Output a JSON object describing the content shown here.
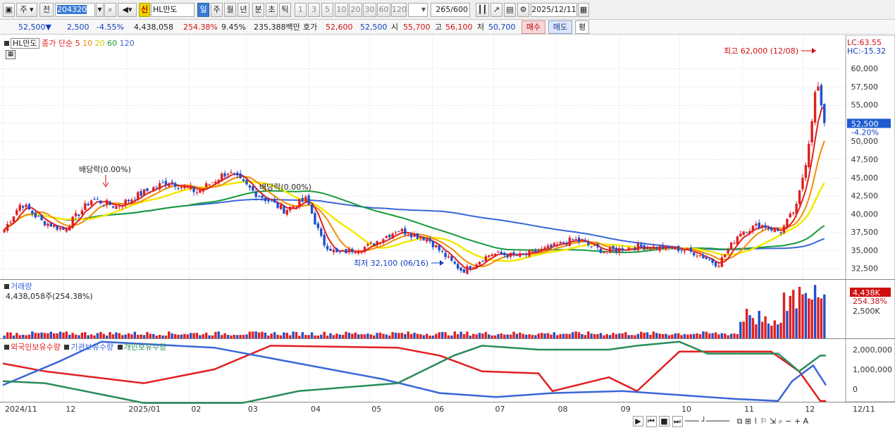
{
  "toolbar": {
    "market": "주",
    "prefix": "전",
    "code": "204320",
    "credit_badge": "신",
    "stock_name": "HL만도",
    "periods": [
      "일",
      "주",
      "월",
      "년",
      "분",
      "초",
      "틱"
    ],
    "active_period": "일",
    "intervals": [
      "1",
      "3",
      "5",
      "10",
      "20",
      "30",
      "60",
      "120"
    ],
    "count": "265",
    "count_max": "/600",
    "date": "2025/12/11"
  },
  "quote": {
    "price": "52,500",
    "direction": "▼",
    "change": "2,500",
    "change_pct": "-4.55%",
    "volume": "4,438,058",
    "volume_ratio": "254.38%",
    "turnover": "9.45%",
    "amount": "235,388백만",
    "ask_label": "호가",
    "ask": "52,600",
    "bid": "52,500",
    "open_label": "시",
    "open": "55,700",
    "high_label": "고",
    "high": "56,100",
    "low_label": "저",
    "low": "50,700",
    "buy_label": "매수",
    "sell_label": "매도",
    "eval_label": "평"
  },
  "price_legend": {
    "name": "HL만도",
    "ma_label": "종가 단순",
    "periods": [
      "5",
      "10",
      "20",
      "60",
      "120"
    ]
  },
  "volume_legend": {
    "title": "거래량",
    "value": "4,438,058주(254.38%)"
  },
  "holder_legend": {
    "foreign": "외국인보유수량",
    "institution": "기관보유수량",
    "individual": "개인보유수량"
  },
  "colors": {
    "up": "#e02020",
    "down": "#2050d0",
    "ma5": "#e02020",
    "ma10": "#f08c00",
    "ma20": "#f5e800",
    "ma60": "#1a9a3a",
    "ma120": "#3a66d8",
    "foreign": "#e02020",
    "institution": "#3a66d8",
    "individual": "#2a8c5a"
  },
  "chart_data": [
    {
      "type": "candlestick",
      "title": "HL만도",
      "y_ticks": [
        "32,500",
        "35,000",
        "37,500",
        "40,000",
        "42,500",
        "45,000",
        "47,500",
        "50,000",
        "52,500",
        "55,000",
        "57,500",
        "60,000"
      ],
      "ylim": [
        31000,
        64000
      ],
      "x_ticks": [
        "2024/11",
        "12",
        "2025/01",
        "02",
        "03",
        "04",
        "05",
        "06",
        "07",
        "08",
        "09",
        "10",
        "11",
        "12",
        "12/11"
      ],
      "series_close": [
        {
          "x": "2024-11-01",
          "y": 37500
        },
        {
          "x": "2024-11-10",
          "y": 41500
        },
        {
          "x": "2024-11-20",
          "y": 39000
        },
        {
          "x": "2024-12-01",
          "y": 37800
        },
        {
          "x": "2024-12-15",
          "y": 42000
        },
        {
          "x": "2024-12-27",
          "y": 41000
        },
        {
          "x": "2025-01-10",
          "y": 43000
        },
        {
          "x": "2025-01-22",
          "y": 44500
        },
        {
          "x": "2025-02-05",
          "y": 43000
        },
        {
          "x": "2025-02-20",
          "y": 45800
        },
        {
          "x": "2025-03-05",
          "y": 43000
        },
        {
          "x": "2025-03-20",
          "y": 40500
        },
        {
          "x": "2025-03-31",
          "y": 42000
        },
        {
          "x": "2025-04-08",
          "y": 36000
        },
        {
          "x": "2025-04-15",
          "y": 34500
        },
        {
          "x": "2025-04-30",
          "y": 35500
        },
        {
          "x": "2025-05-15",
          "y": 37800
        },
        {
          "x": "2025-05-30",
          "y": 36500
        },
        {
          "x": "2025-06-10",
          "y": 33500
        },
        {
          "x": "2025-06-16",
          "y": 32100
        },
        {
          "x": "2025-06-30",
          "y": 34500
        },
        {
          "x": "2025-07-15",
          "y": 34200
        },
        {
          "x": "2025-07-31",
          "y": 35500
        },
        {
          "x": "2025-08-10",
          "y": 36500
        },
        {
          "x": "2025-08-25",
          "y": 34800
        },
        {
          "x": "2025-09-10",
          "y": 35500
        },
        {
          "x": "2025-09-30",
          "y": 35200
        },
        {
          "x": "2025-10-10",
          "y": 34500
        },
        {
          "x": "2025-10-20",
          "y": 33000
        },
        {
          "x": "2025-10-31",
          "y": 37500
        },
        {
          "x": "2025-11-10",
          "y": 38500
        },
        {
          "x": "2025-11-20",
          "y": 37500
        },
        {
          "x": "2025-11-28",
          "y": 41000
        },
        {
          "x": "2025-12-03",
          "y": 48000
        },
        {
          "x": "2025-12-08",
          "y": 58500
        },
        {
          "x": "2025-12-11",
          "y": 52500
        }
      ],
      "series": [
        {
          "name": "5",
          "color": "#e02020"
        },
        {
          "name": "10",
          "color": "#f08c00"
        },
        {
          "name": "20",
          "color": "#f5e800"
        },
        {
          "name": "60",
          "color": "#1a9a3a"
        },
        {
          "name": "120",
          "color": "#3a66d8"
        }
      ],
      "annotations": [
        {
          "text": "최고 62,000 (12/08)"
        },
        {
          "text": "최저 32,100 (06/16)"
        },
        {
          "text": "배당락(0.00%)"
        },
        {
          "text": "배당락(0.00%)"
        }
      ],
      "right_labels": {
        "lc": "LC:63.55",
        "hc": "HC:-15.32",
        "price": "52,500",
        "pct": "-4.20%"
      }
    },
    {
      "type": "bar",
      "title": "거래량",
      "y_ticks": [
        "2,500K"
      ],
      "last_value_label": "4,438K",
      "last_pct_label": "254.38%"
    },
    {
      "type": "line",
      "y_ticks": [
        "2,000,000",
        "1,000,000",
        "0"
      ],
      "series": [
        {
          "name": "외국인보유수량",
          "color": "#e02020"
        },
        {
          "name": "기관보유수량",
          "color": "#3a66d8"
        },
        {
          "name": "개인보유수량",
          "color": "#2a8c5a"
        }
      ]
    }
  ]
}
